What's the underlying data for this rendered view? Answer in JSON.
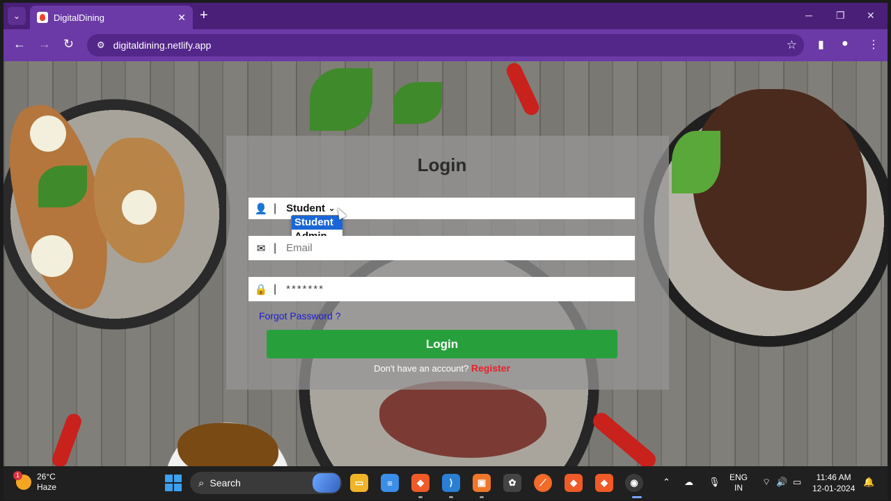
{
  "browser": {
    "tab_title": "DigitalDining",
    "url": "digitaldining.netlify.app",
    "new_tab": "+",
    "close_tab": "✕"
  },
  "login": {
    "title": "Login",
    "role_selected": "Student",
    "role_options": [
      "Student",
      "Admin"
    ],
    "email_placeholder": "Email",
    "password_value": "*******",
    "forgot_link": "Forgot Password ?",
    "button_label": "Login",
    "signup_prompt": "Don't have an account?",
    "register_link": "Register"
  },
  "taskbar": {
    "weather_temp": "26°C",
    "weather_desc": "Haze",
    "weather_badge": "1",
    "search_label": "Search",
    "lang_top": "ENG",
    "lang_bottom": "IN",
    "time": "11:46 AM",
    "date": "12-01-2024"
  },
  "colors": {
    "tab_bar": "#4a1f78",
    "toolbar": "#6b3aa6",
    "login_button": "#27a03c",
    "register_link": "#e8202a",
    "forgot_link": "#1b1bd1",
    "dropdown_highlight": "#1a66d6"
  },
  "icons": [
    "tab-list-icon",
    "favicon-icon",
    "back-arrow-icon",
    "forward-arrow-icon",
    "reload-icon",
    "site-info-icon",
    "bookmark-star-icon",
    "sidebar-icon",
    "profile-icon",
    "kebab-menu-icon",
    "user-icon",
    "envelope-icon",
    "lock-icon",
    "windows-start-icon",
    "search-icon",
    "file-explorer-icon",
    "notepad-icon",
    "brave-icon",
    "vscode-icon",
    "openai-icon",
    "chrome-icon",
    "wifi-icon",
    "volume-icon",
    "battery-icon",
    "microphone-icon"
  ]
}
